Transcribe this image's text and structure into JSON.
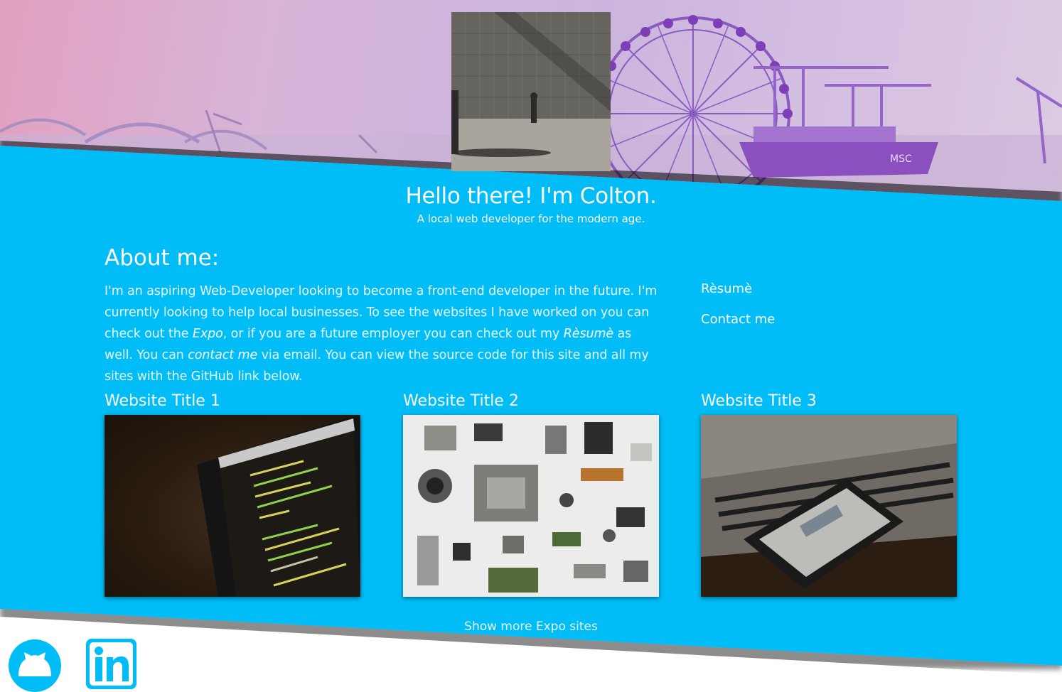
{
  "hero": {
    "headline": "Hello there! I'm Colton.",
    "tagline": "A local web developer for the modern age."
  },
  "about": {
    "title": "About me:",
    "text_1": "I'm an aspiring Web-Developer looking to become a front-end developer in the future. I'm currently looking to help local businesses. To see the websites I have worked on you can check out the ",
    "expo_link": "Expo",
    "text_2": ", or if you are a future employer you can check out my ",
    "resume_link": "Rèsumè",
    "text_3": " as well. You can ",
    "contact_link": "contact me",
    "text_4": " via email. You can view the source code for this site and all my sites with the GitHub link below."
  },
  "side_nav": {
    "resume": "Rèsumè",
    "contact": "Contact me"
  },
  "projects": [
    {
      "title": "Website Title 1"
    },
    {
      "title": "Website Title 2"
    },
    {
      "title": "Website Title 3"
    }
  ],
  "show_more": "Show more Expo sites",
  "colors": {
    "band": "#00bdf7",
    "text": "#ffffff"
  },
  "icons": {
    "github": "github-icon",
    "linkedin": "linkedin-icon"
  }
}
